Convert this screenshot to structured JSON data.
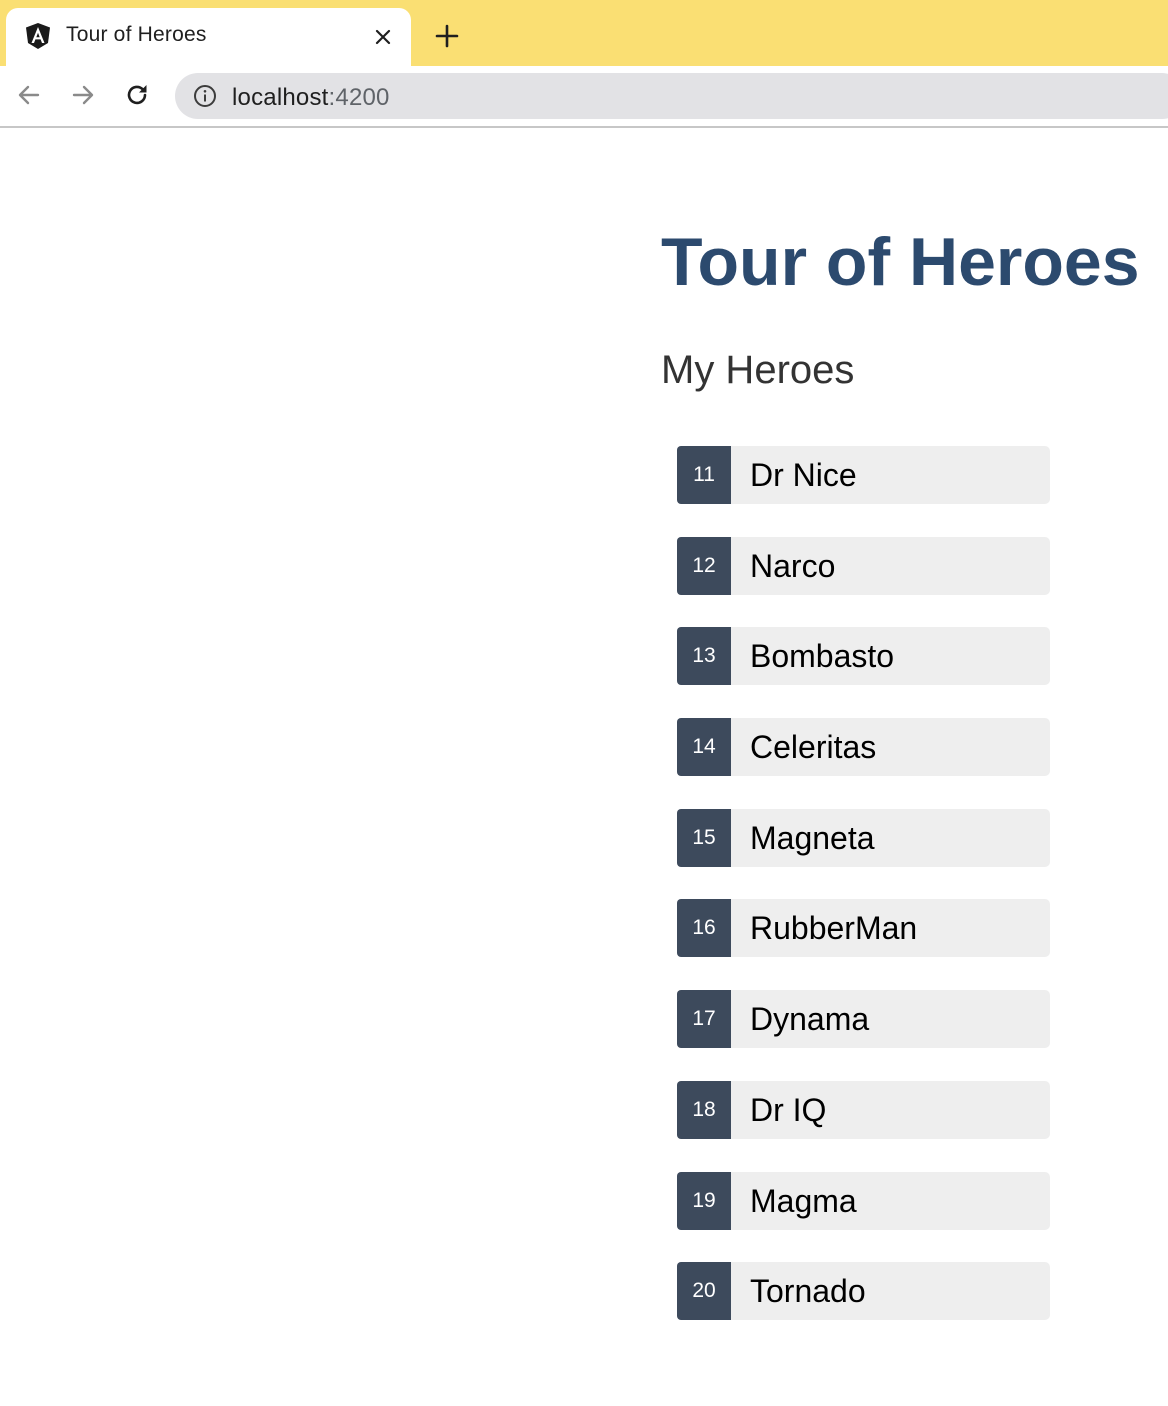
{
  "browser": {
    "tab": {
      "title": "Tour of Heroes",
      "favicon": "angular-logo-icon",
      "close_icon": "close-icon"
    },
    "new_tab_icon": "plus-icon",
    "nav": {
      "back_icon": "arrow-left-icon",
      "forward_icon": "arrow-right-icon",
      "reload_icon": "reload-icon"
    },
    "address_bar": {
      "info_icon": "info-icon",
      "host": "localhost",
      "port": ":4200"
    },
    "colors": {
      "tabbar_bg": "#fadf73",
      "omnibox_bg": "#e2e2e5"
    }
  },
  "app": {
    "title": "Tour of Heroes",
    "section_title": "My Heroes",
    "heroes": [
      {
        "id": "11",
        "name": "Dr Nice"
      },
      {
        "id": "12",
        "name": "Narco"
      },
      {
        "id": "13",
        "name": "Bombasto"
      },
      {
        "id": "14",
        "name": "Celeritas"
      },
      {
        "id": "15",
        "name": "Magneta"
      },
      {
        "id": "16",
        "name": "RubberMan"
      },
      {
        "id": "17",
        "name": "Dynama"
      },
      {
        "id": "18",
        "name": "Dr IQ"
      },
      {
        "id": "19",
        "name": "Magma"
      },
      {
        "id": "20",
        "name": "Tornado"
      }
    ],
    "colors": {
      "title": "#2c4a6e",
      "badge_bg": "#3d4a5c",
      "item_bg": "#eeeeee"
    }
  }
}
